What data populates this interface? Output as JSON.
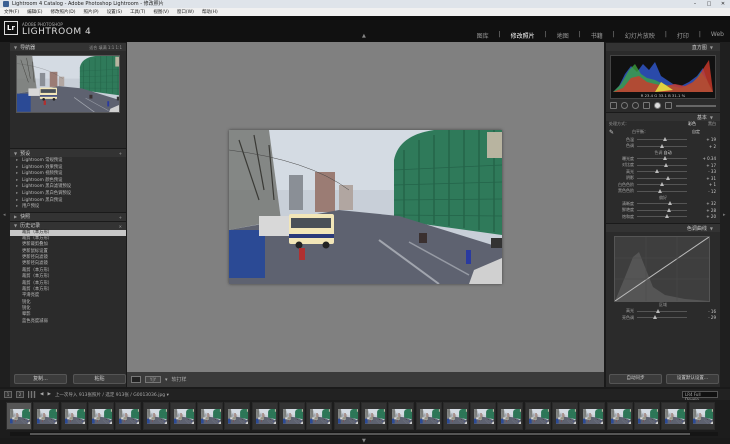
{
  "titlebar": {
    "title": "Lightroom 4 Catalog - Adobe Photoshop Lightroom - 修改照片",
    "minimize": "–",
    "maximize": "□",
    "close": "✕"
  },
  "menu": [
    "文件(F)",
    "编辑(E)",
    "修改照片(D)",
    "照片(P)",
    "设置(S)",
    "工具(T)",
    "视图(V)",
    "窗口(W)",
    "帮助(H)"
  ],
  "identity": {
    "logo": "Lr",
    "subtitle": "ADOBE PHOTOSHOP",
    "product": "LIGHTROOM 4"
  },
  "modules": [
    {
      "label": "图库",
      "active": false
    },
    {
      "label": "修改照片",
      "active": true
    },
    {
      "label": "地图",
      "active": false
    },
    {
      "label": "书籍",
      "active": false
    },
    {
      "label": "幻灯片放映",
      "active": false
    },
    {
      "label": "打印",
      "active": false
    },
    {
      "label": "Web",
      "active": false
    }
  ],
  "left": {
    "navigator": {
      "title": "导航器",
      "modes": "适合 填满 1:1 1:1"
    },
    "presets": {
      "title": "预设",
      "items": [
        "Lightroom 常规预设",
        "Lightroom 效果预设",
        "Lightroom 视频预设",
        "Lightroom 颜色预设",
        "Lightroom 黑白滤镜预设",
        "Lightroom 黑白色调预设",
        "Lightroom 黑白预设",
        "用户预设"
      ]
    },
    "snapshots": {
      "title": "快照"
    },
    "history": {
      "title": "历史记录",
      "items": [
        {
          "name": "裁剪（本方形）",
          "a": "",
          "b": ""
        },
        {
          "name": "裁剪（本方形）",
          "a": "",
          "b": ""
        },
        {
          "name": "更新裁剪叠加",
          "a": "",
          "b": ""
        },
        {
          "name": "更新鼠标设置",
          "a": "",
          "b": ""
        },
        {
          "name": "更新径向滤镜",
          "a": "",
          "b": ""
        },
        {
          "name": "更新径向滤镜",
          "a": "",
          "b": ""
        },
        {
          "name": "裁剪（本方形）",
          "a": "",
          "b": ""
        },
        {
          "name": "裁剪（本方形）",
          "a": "",
          "b": ""
        },
        {
          "name": "裁剪（本方形）",
          "a": "",
          "b": ""
        },
        {
          "name": "裁剪（本方形）",
          "a": "",
          "b": ""
        },
        {
          "name": "平滑亮度",
          "a": "",
          "b": ""
        },
        {
          "name": "锐化",
          "a": "",
          "b": ""
        },
        {
          "name": "锐化",
          "a": "",
          "b": ""
        },
        {
          "name": "晕影",
          "a": "",
          "b": ""
        },
        {
          "name": "蓝色亮度减弱",
          "a": "",
          "b": ""
        }
      ],
      "selected_index": 0
    },
    "buttons": {
      "copy": "复制...",
      "paste": "粘贴"
    }
  },
  "right": {
    "histogram": {
      "title": "直方图",
      "info": "R  23.4  G  33.1  B  31.1 %"
    },
    "basic": {
      "title": "基本",
      "treatment": {
        "label": "处理方式：",
        "color": "彩色",
        "bw": "黑白"
      },
      "wb": {
        "label": "白平衡：",
        "value": "自定"
      },
      "sliders_wb": [
        {
          "label": "色温",
          "value": "+ 19",
          "pos": 0.55
        },
        {
          "label": "色调",
          "value": "+ 2",
          "pos": 0.5
        }
      ],
      "tone_header": "色调",
      "tone_auto": "自动",
      "sliders_tone": [
        {
          "label": "曝光度",
          "value": "+ 0.34",
          "pos": 0.55
        },
        {
          "label": "对比度",
          "value": "+ 17",
          "pos": 0.58
        },
        {
          "label": "高光",
          "value": "- 33",
          "pos": 0.4
        },
        {
          "label": "阴影",
          "value": "+ 31",
          "pos": 0.62
        },
        {
          "label": "白色色阶",
          "value": "+ 1",
          "pos": 0.5
        },
        {
          "label": "黑色色阶",
          "value": "- 12",
          "pos": 0.46
        }
      ],
      "presence_header": "偏好",
      "sliders_presence": [
        {
          "label": "清晰度",
          "value": "+ 32",
          "pos": 0.65
        },
        {
          "label": "鲜艳度",
          "value": "+ 28",
          "pos": 0.63
        },
        {
          "label": "饱和度",
          "value": "+ 20",
          "pos": 0.6
        }
      ]
    },
    "tone_curve": {
      "title": "色调曲线",
      "region": "区域",
      "sliders": [
        {
          "label": "高光",
          "value": "- 16",
          "pos": 0.42
        },
        {
          "label": "亮色调",
          "value": "- 29",
          "pos": 0.36
        }
      ]
    },
    "buttons": {
      "previous": "自动同步",
      "reset": "设置默认设置..."
    }
  },
  "toolbar": {
    "softproof": "软打样"
  },
  "filmbar": {
    "text": "上一次导入  913张照片 / 选定 913张 / G0013036.jpg ▾",
    "filter": "LR4 Full Develo...",
    "page1": "1",
    "page2": "2"
  },
  "filmstrip_count": 26
}
